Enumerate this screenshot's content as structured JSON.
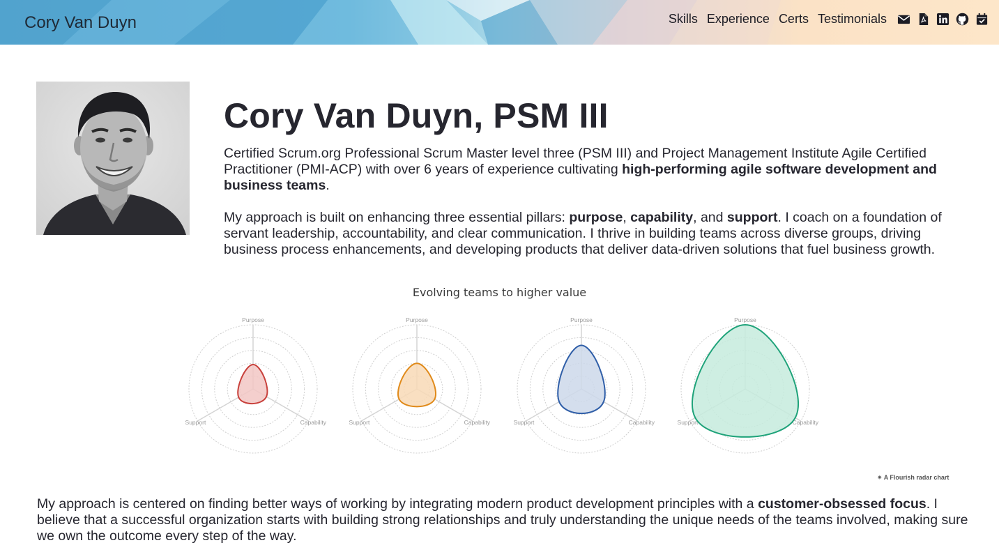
{
  "brand": "Cory Van Duyn",
  "nav": {
    "links": [
      "Skills",
      "Experience",
      "Certs",
      "Testimonials"
    ],
    "icons": [
      "envelope-icon",
      "pdf-file-icon",
      "linkedin-icon",
      "github-icon",
      "calendar-check-icon"
    ]
  },
  "hero": {
    "title": "Cory Van Duyn, PSM III",
    "p1_a": "Certified Scrum.org Professional Scrum Master level three (PSM III) and Project Management Institute Agile Certified Practitioner (PMI-ACP) with over 6 years of experience cultivating ",
    "p1_b": "high-performing agile software development and business teams",
    "p1_c": ".",
    "p2_a": "My approach is built on enhancing three essential pillars: ",
    "p2_b": "purpose",
    "p2_c": ", ",
    "p2_d": "capability",
    "p2_e": ", and ",
    "p2_f": "support",
    "p2_g": ". I coach on a foundation of servant leadership, accountability, and clear communication. I thrive in building teams across diverse groups, driving business process enhancements, and developing products that deliver data-driven solutions that fuel business growth."
  },
  "chart_title": "Evolving teams to higher value",
  "chart_data": {
    "type": "radar",
    "axes": [
      "Purpose",
      "Capability",
      "Support"
    ],
    "max": 5,
    "series": [
      {
        "values": [
          1.9,
          1.2,
          1.3
        ],
        "color": "#c8413c",
        "fill": "#f2c7c4"
      },
      {
        "values": [
          2.0,
          1.6,
          1.6
        ],
        "color": "#e08a1a",
        "fill": "#f8d9b6"
      },
      {
        "values": [
          3.4,
          2.0,
          2.0
        ],
        "color": "#2f5ea8",
        "fill": "#cdd8ea"
      },
      {
        "values": [
          5.0,
          4.5,
          4.5
        ],
        "color": "#1fa37a",
        "fill": "#c5ebdd"
      }
    ]
  },
  "credit": "A Flourish radar chart",
  "bottom": {
    "a": "My approach is centered on finding better ways of working by integrating modern product development principles with a ",
    "b": "customer-obsessed focus",
    "c": ". I believe that a successful organization starts with building strong relationships and truly understanding the unique needs of the teams involved, making sure we own the outcome every step of the way."
  }
}
